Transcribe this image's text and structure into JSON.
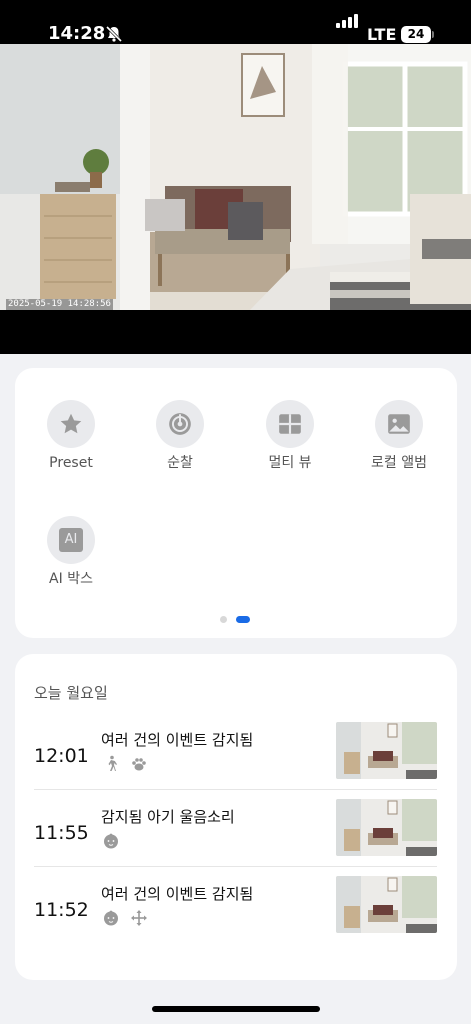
{
  "status_bar": {
    "time": "14:28",
    "network": "LTE",
    "battery": "24",
    "icons": [
      "bell-off-icon",
      "signal-icon",
      "battery-icon"
    ]
  },
  "camera": {
    "timestamp": "2025-05-19  14:28:56"
  },
  "menu": {
    "items": [
      {
        "label": "Preset",
        "icon": "star-icon"
      },
      {
        "label": "순찰",
        "icon": "patrol-icon"
      },
      {
        "label": "멀티 뷰",
        "icon": "multi-view-icon"
      },
      {
        "label": "로컬 앨범",
        "icon": "album-icon"
      },
      {
        "label": "AI 박스",
        "icon": "ai-box-icon",
        "icon_text": "AI"
      }
    ],
    "page_count": 2,
    "active_page": 2,
    "colors": {
      "active_dot": "#1a6be6",
      "inactive_dot": "#d8d8d8",
      "icon_bg": "#e9eaed",
      "icon_fg": "#9a9a9a"
    }
  },
  "events": {
    "header": "오늘 월요일",
    "items": [
      {
        "time": "12:01",
        "title": "여러 건의 이벤트 감지됨",
        "icons": [
          "person-walking-icon",
          "paw-icon"
        ]
      },
      {
        "time": "11:55",
        "title": "감지됨 아기 울음소리",
        "icons": [
          "baby-face-icon"
        ]
      },
      {
        "time": "11:52",
        "title": "여러 건의 이벤트 감지됨",
        "icons": [
          "baby-face-icon",
          "motion-arrows-icon"
        ]
      }
    ]
  }
}
